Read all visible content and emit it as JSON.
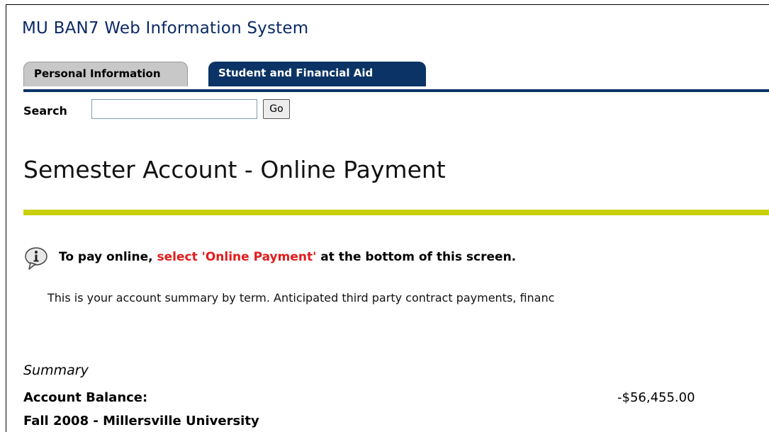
{
  "header": {
    "app_title": "MU BAN7 Web Information System"
  },
  "tabs": [
    {
      "label": "Personal Information",
      "active": false
    },
    {
      "label": "Student and Financial Aid",
      "active": true
    }
  ],
  "search": {
    "label": "Search",
    "value": "",
    "placeholder": "",
    "button_label": "Go"
  },
  "page": {
    "title": "Semester Account - Online Payment"
  },
  "info": {
    "icon": "info-icon",
    "text_before": "To pay online, ",
    "text_highlight": "select 'Online Payment'",
    "text_after": " at the bottom of this screen."
  },
  "intro": {
    "text": "This is your account summary by term. Anticipated third party contract payments, financ"
  },
  "summary": {
    "heading": "Summary",
    "balance_label": "Account Balance:",
    "balance_value": "-$56,455.00",
    "term_label": "Fall 2008 - Millersville University"
  },
  "colors": {
    "tab_active": "#0b3366",
    "tab_inactive": "#c8c8c8",
    "accent_rule": "#c9d00b",
    "highlight": "#e21b1b",
    "title_blue": "#0b2a66"
  }
}
